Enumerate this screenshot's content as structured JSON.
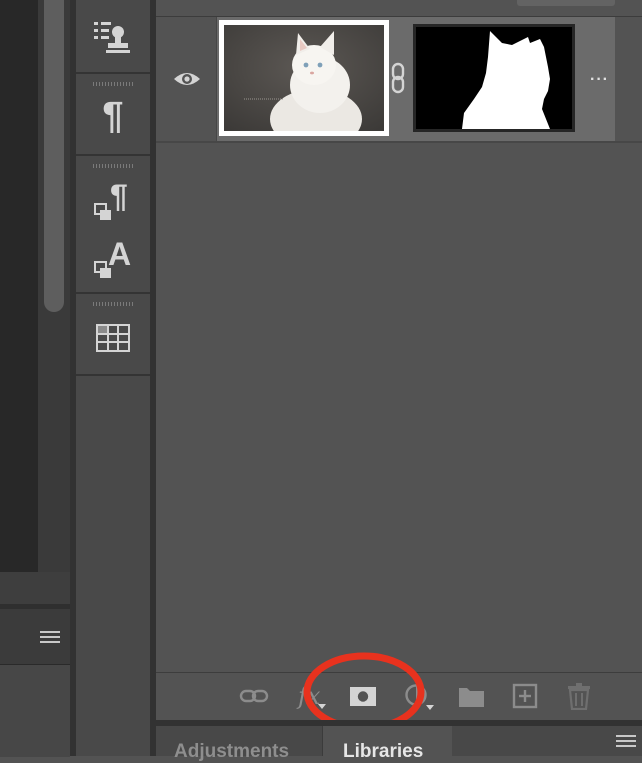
{
  "layers_panel": {
    "layer": {
      "visibility_icon": "eye-icon",
      "link_icon": "chain-link-icon",
      "options_label": "···",
      "thumbnail_icon": "kitten-photo",
      "mask_icon": "layer-mask-silhouette"
    },
    "bottom_toolbar": [
      {
        "id": "link-layers",
        "icon": "link-icon"
      },
      {
        "id": "add-layer-style",
        "icon": "fx-icon"
      },
      {
        "id": "add-layer-mask",
        "icon": "mask-icon"
      },
      {
        "id": "new-fill-adjustment-layer",
        "icon": "half-circle-icon"
      },
      {
        "id": "new-group",
        "icon": "folder-icon"
      },
      {
        "id": "new-layer",
        "icon": "plus-square-icon"
      },
      {
        "id": "delete-layer",
        "icon": "trash-icon"
      }
    ],
    "fx_label": "fx"
  },
  "tool_strip": [
    {
      "id": "clone-source",
      "icon": "stamp-list-icon"
    },
    {
      "id": "paragraph",
      "icon": "pilcrow-icon",
      "label": "¶"
    },
    {
      "id": "paragraph-styles",
      "icon": "paragraph-styles-icon",
      "label": "¶"
    },
    {
      "id": "character-styles",
      "icon": "character-styles-icon",
      "label": "A"
    },
    {
      "id": "tables",
      "icon": "grid-table-icon"
    }
  ],
  "bottom_tabs": {
    "adjustments": "Adjustments",
    "libraries": "Libraries"
  },
  "annotation": {
    "color": "#e8321e",
    "target": "add-layer-mask"
  },
  "colors": {
    "panel_bg": "#535353",
    "row_selected": "#6b6b6b",
    "icon": "#d4d4d4"
  }
}
